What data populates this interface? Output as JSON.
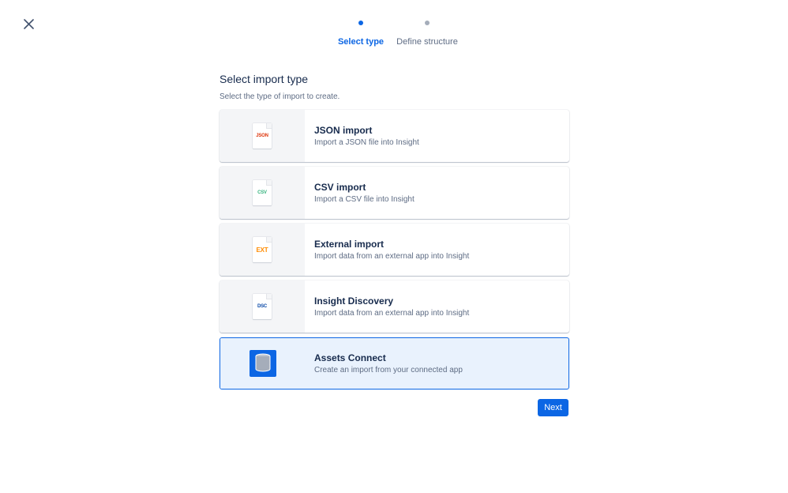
{
  "stepper": {
    "steps": [
      {
        "label": "Select type",
        "active": true
      },
      {
        "label": "Define structure",
        "active": false
      }
    ]
  },
  "header": {
    "title": "Select import type",
    "subtitle": "Select the type of import to create."
  },
  "import_types": [
    {
      "name": "JSON import",
      "description": "Import a JSON file into Insight",
      "icon_label": "JSON",
      "icon_color": "#de350b",
      "icon": "json-file-icon"
    },
    {
      "name": "CSV import",
      "description": "Import a CSV file into Insight",
      "icon_label": "CSV",
      "icon_color": "#36b37e",
      "icon": "csv-file-icon"
    },
    {
      "name": "External import",
      "description": "Import data from an external app into Insight",
      "icon_label": "EXT",
      "icon_color": "#ff8b00",
      "icon": "ext-file-icon"
    },
    {
      "name": "Insight Discovery",
      "description": "Import data from an external app into Insight",
      "icon_label": "DSC",
      "icon_color": "#0747a6",
      "icon": "dsc-file-icon"
    },
    {
      "name": "Assets Connect",
      "description": "Create an import from your connected app",
      "icon": "database-icon",
      "selected": true
    }
  ],
  "actions": {
    "next_label": "Next"
  },
  "colors": {
    "primary": "#0c66e4",
    "selected_bg": "#e9f2fd",
    "text": "#172b4d",
    "subtle_text": "#5e6c84"
  }
}
